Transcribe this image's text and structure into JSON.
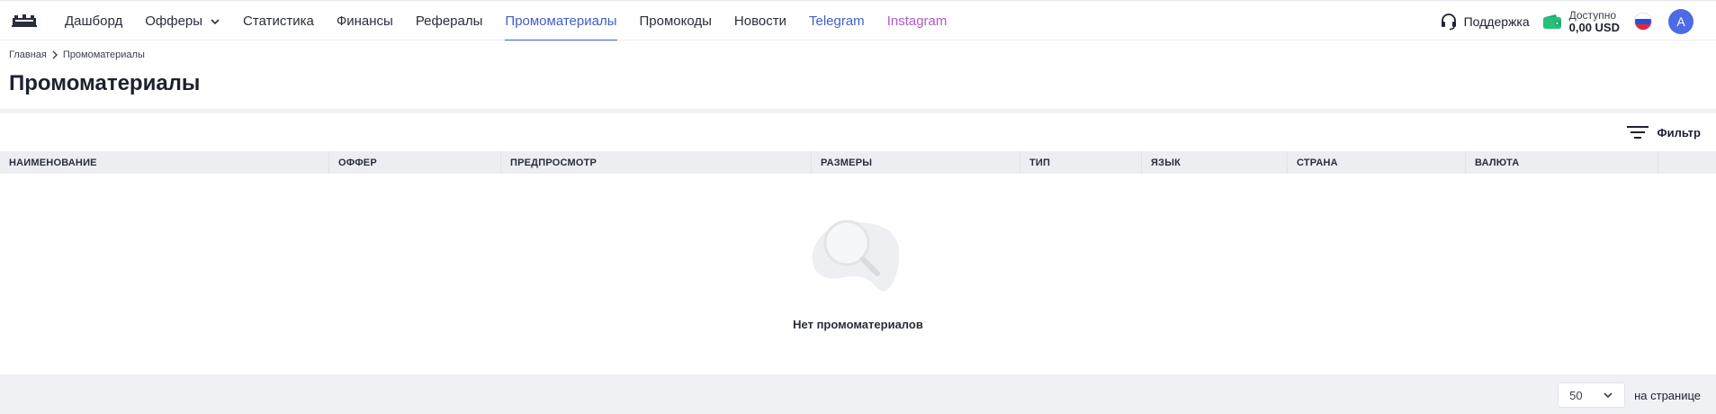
{
  "nav": {
    "items": [
      {
        "label": "Дашборд"
      },
      {
        "label": "Офферы"
      },
      {
        "label": "Статистика"
      },
      {
        "label": "Финансы"
      },
      {
        "label": "Рефералы"
      },
      {
        "label": "Промоматериалы"
      },
      {
        "label": "Промокоды"
      },
      {
        "label": "Новости"
      },
      {
        "label": "Telegram"
      },
      {
        "label": "Instagram"
      }
    ],
    "active_index": 5
  },
  "header": {
    "support_label": "Поддержка",
    "balance_label": "Доступно",
    "balance_value": "0,00 USD",
    "avatar_letter": "A",
    "language_flag": "ru-flag"
  },
  "breadcrumb": {
    "home": "Главная",
    "current": "Промоматериалы"
  },
  "page": {
    "title": "Промоматериалы"
  },
  "toolbar": {
    "filter_label": "Фильтр"
  },
  "table": {
    "columns": [
      "НАИМЕНОВАНИЕ",
      "ОФФЕР",
      "ПРЕДПРОСМОТР",
      "РАЗМЕРЫ",
      "ТИП",
      "ЯЗЫК",
      "СТРАНА",
      "ВАЛЮТА"
    ],
    "empty_text": "Нет промоматериалов"
  },
  "pagination": {
    "per_page_value": "50",
    "per_page_label": "на странице"
  },
  "colors": {
    "accent": "#3f5fc9",
    "instagram": "#b05cc8",
    "wallet": "#27c07a",
    "avatar": "#4e6be6"
  }
}
